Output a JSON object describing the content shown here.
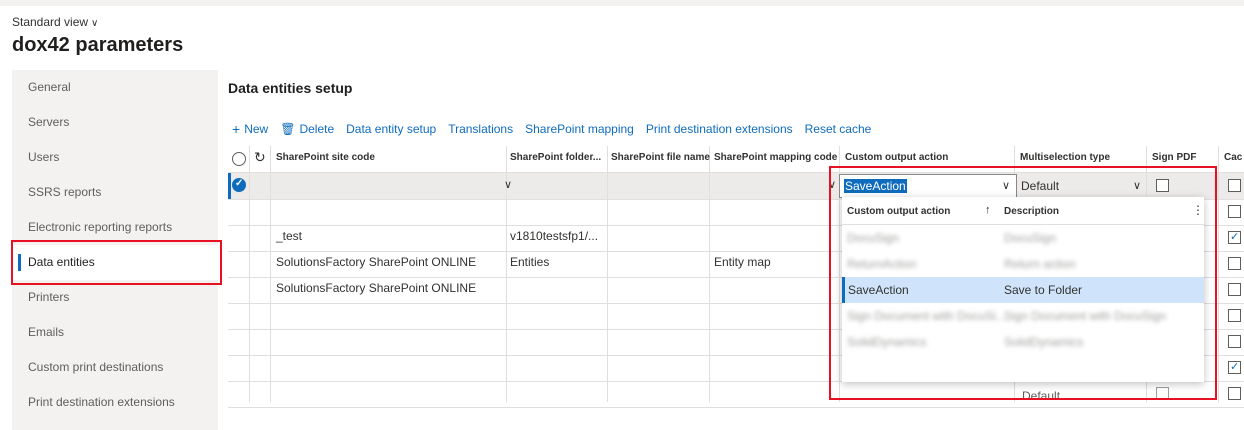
{
  "header": {
    "view_label": "Standard view",
    "title": "dox42 parameters"
  },
  "sidebar": {
    "items": [
      {
        "label": "General"
      },
      {
        "label": "Servers"
      },
      {
        "label": "Users"
      },
      {
        "label": "SSRS reports"
      },
      {
        "label": "Electronic reporting reports"
      },
      {
        "label": "Data entities"
      },
      {
        "label": "Printers"
      },
      {
        "label": "Emails"
      },
      {
        "label": "Custom print destinations"
      },
      {
        "label": "Print destination extensions"
      }
    ],
    "active": "Data entities"
  },
  "section": {
    "title": "Data entities setup"
  },
  "toolbar": {
    "new": "New",
    "delete": "Delete",
    "data_entity_setup": "Data entity setup",
    "translations": "Translations",
    "sharepoint_mapping": "SharePoint mapping",
    "print_destination_extensions": "Print destination extensions",
    "reset_cache": "Reset cache"
  },
  "grid": {
    "columns": [
      "SharePoint site code",
      "SharePoint folder...",
      "SharePoint file name",
      "SharePoint mapping code",
      "Custom output action",
      "Multiselection type",
      "Sign PDF",
      "Cac"
    ],
    "rows": [
      {
        "site": "",
        "folder": "",
        "file": "",
        "mapping": ""
      },
      {
        "site": "",
        "folder": "",
        "file": "",
        "mapping": ""
      },
      {
        "site": "_test",
        "folder": "v1810testsfp1/...",
        "file": "",
        "mapping": ""
      },
      {
        "site": "SolutionsFactory SharePoint ONLINE",
        "folder": "Entities",
        "file": "",
        "mapping": "Entity map"
      },
      {
        "site": "SolutionsFactory SharePoint ONLINE",
        "folder": "",
        "file": "",
        "mapping": ""
      }
    ],
    "editing": {
      "custom_output_action": "SaveAction",
      "multiselection_type": "Default"
    },
    "last_row_multiselection": "Default"
  },
  "dropdown": {
    "col_action": "Custom output action",
    "col_description": "Description",
    "rows": [
      {
        "action": "DocuSign",
        "description": "DocuSign"
      },
      {
        "action": "ReturnAction",
        "description": "Return action"
      },
      {
        "action": "SaveAction",
        "description": "Save to Folder"
      },
      {
        "action": "Sign Document with DocuSi...",
        "description": "Sign Document with DocuSign"
      },
      {
        "action": "SolidDynamics",
        "description": "SolidDynamics"
      }
    ]
  },
  "colors": {
    "accent": "#0f6cbd",
    "highlight": "#e81123"
  }
}
